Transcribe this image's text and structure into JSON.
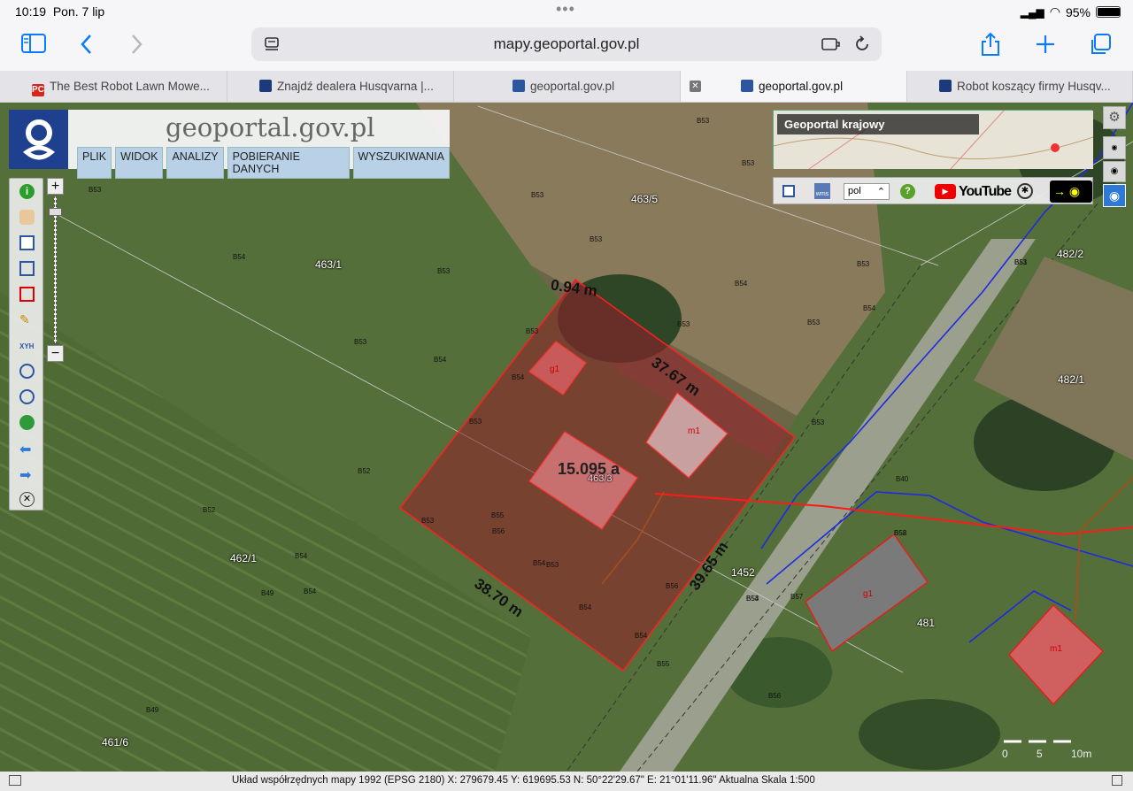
{
  "status": {
    "time": "10:19",
    "date": "Pon. 7 lip",
    "battery": "95%",
    "battery_level": 0.95
  },
  "toolbar": {
    "url": "mapy.geoportal.gov.pl"
  },
  "tabs": [
    {
      "label": "The Best Robot Lawn Mowe...",
      "fav_color": "#d9231d"
    },
    {
      "label": "Znajdź dealera Husqvarna |...",
      "fav_color": "#1b3a7a"
    },
    {
      "label": "geoportal.gov.pl",
      "fav_color": "#2c56a0"
    },
    {
      "label": "geoportal.gov.pl",
      "fav_color": "#2c56a0"
    },
    {
      "label": "Robot koszący firmy Husqv...",
      "fav_color": "#1b3a7a"
    }
  ],
  "logo": {
    "title": "geoportal.gov.pl"
  },
  "menu": [
    "PLIK",
    "WIDOK",
    "ANALIZY",
    "POBIERANIE DANYCH",
    "WYSZUKIWANIA"
  ],
  "minimap": {
    "label": "Geoportal krajowy"
  },
  "righttools": {
    "language": "pol",
    "youtube": "YouTube"
  },
  "map": {
    "parcels": [
      "463/5",
      "463/1",
      "482/2",
      "482/1",
      "462/1",
      "461/6",
      "481",
      "463/3"
    ],
    "area": "15.095 a",
    "dims": [
      "0.94 m",
      "37.67 m",
      "39.65 m",
      "38.70 m"
    ],
    "buildings": [
      "g1",
      "m1",
      "g1",
      "m1"
    ],
    "elev_labels": [
      "B53",
      "B53",
      "B53",
      "B53",
      "B54",
      "B53",
      "B53",
      "B53",
      "B54",
      "B54",
      "B53",
      "B53",
      "B53",
      "B53",
      "B54",
      "B54",
      "B53",
      "B52",
      "B52",
      "B55",
      "B53",
      "B54",
      "B56",
      "B53",
      "B54",
      "B56",
      "B54",
      "B54",
      "B49",
      "B54",
      "B55",
      "B56",
      "B58",
      "B57",
      "B54",
      "B40",
      "B51",
      "B53",
      "B53",
      "B52",
      "B53",
      "B49"
    ],
    "misc": [
      "1452"
    ],
    "scalebar": [
      "0",
      "5",
      "10m"
    ]
  },
  "bottombar": {
    "text": "Układ współrzędnych mapy 1992 (EPSG 2180)   X: 279679.45 Y: 619695.53   N: 50°22'29.67\" E: 21°01'11.96\"  Aktualna Skala 1:500"
  }
}
